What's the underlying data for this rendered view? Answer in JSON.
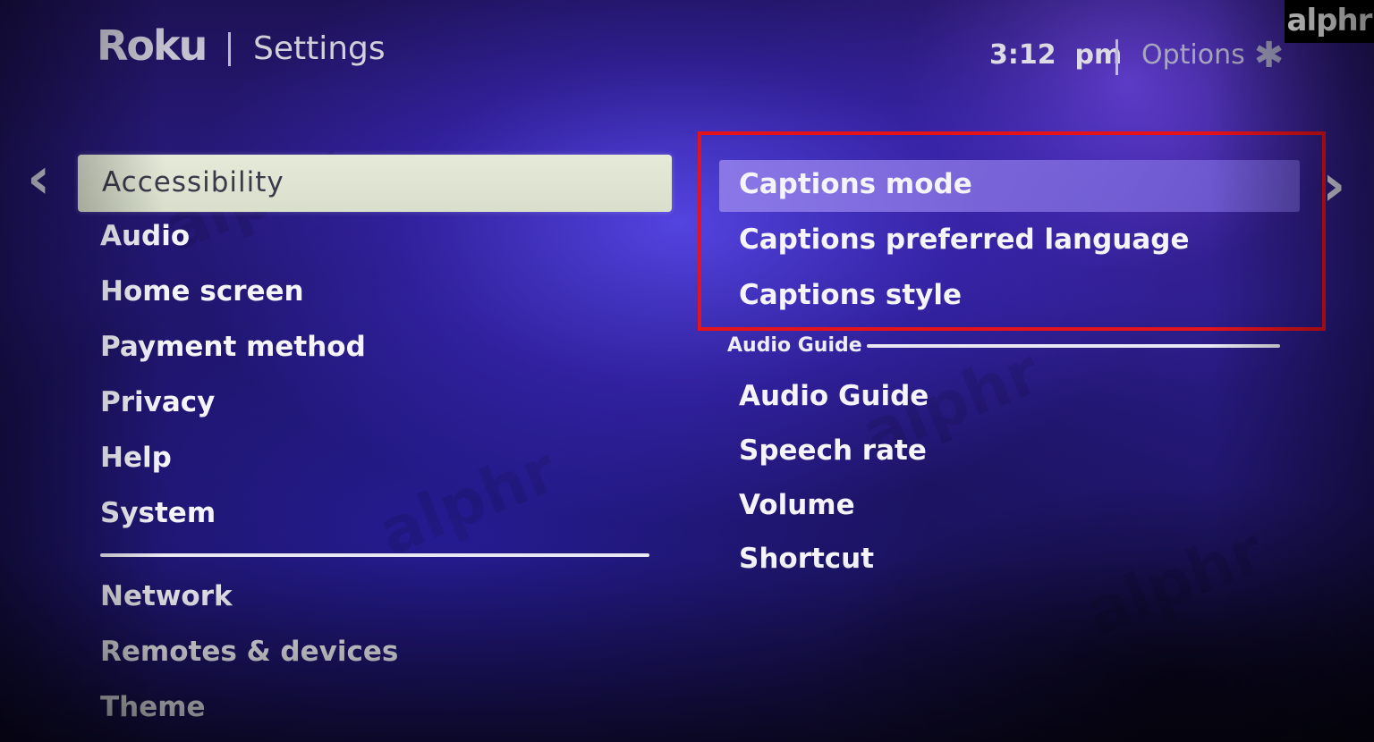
{
  "header": {
    "logo": "Roku",
    "title": "Settings",
    "time": "3:12  pm",
    "options_label": "Options",
    "options_icon": "✱"
  },
  "brand_badge": "alphr",
  "nav": {
    "left_arrow": "‹",
    "right_arrow": "›"
  },
  "left_menu": {
    "selected": "Accessibility",
    "items": [
      "Audio",
      "Home screen",
      "Payment method",
      "Privacy",
      "Help",
      "System"
    ],
    "items_below_divider": [
      "Network",
      "Remotes & devices",
      "Theme"
    ]
  },
  "right_panel": {
    "focused": "Captions mode",
    "captions_items": [
      "Captions preferred language",
      "Captions style"
    ],
    "section_header": "Audio Guide",
    "audio_guide_items": [
      "Audio Guide",
      "Speech rate",
      "Volume",
      "Shortcut"
    ]
  },
  "colors": {
    "highlight_border": "#e8121a",
    "selected_bar": "#e5ead9",
    "focus_bar": "#9682eb"
  },
  "watermarks": [
    "alphr",
    "alphr",
    "alphr",
    "alphr"
  ]
}
